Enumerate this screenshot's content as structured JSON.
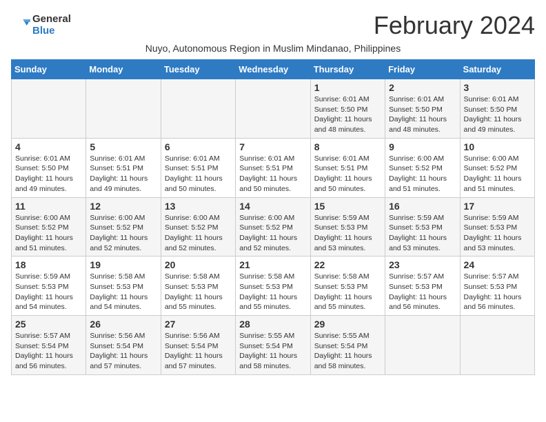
{
  "logo": {
    "general": "General",
    "blue": "Blue"
  },
  "title": "February 2024",
  "subtitle": "Nuyo, Autonomous Region in Muslim Mindanao, Philippines",
  "weekdays": [
    "Sunday",
    "Monday",
    "Tuesday",
    "Wednesday",
    "Thursday",
    "Friday",
    "Saturday"
  ],
  "weeks": [
    [
      {
        "day": "",
        "info": ""
      },
      {
        "day": "",
        "info": ""
      },
      {
        "day": "",
        "info": ""
      },
      {
        "day": "",
        "info": ""
      },
      {
        "day": "1",
        "sunrise": "6:01 AM",
        "sunset": "5:50 PM",
        "daylight": "11 hours and 48 minutes."
      },
      {
        "day": "2",
        "sunrise": "6:01 AM",
        "sunset": "5:50 PM",
        "daylight": "11 hours and 48 minutes."
      },
      {
        "day": "3",
        "sunrise": "6:01 AM",
        "sunset": "5:50 PM",
        "daylight": "11 hours and 49 minutes."
      }
    ],
    [
      {
        "day": "4",
        "sunrise": "6:01 AM",
        "sunset": "5:50 PM",
        "daylight": "11 hours and 49 minutes."
      },
      {
        "day": "5",
        "sunrise": "6:01 AM",
        "sunset": "5:51 PM",
        "daylight": "11 hours and 49 minutes."
      },
      {
        "day": "6",
        "sunrise": "6:01 AM",
        "sunset": "5:51 PM",
        "daylight": "11 hours and 50 minutes."
      },
      {
        "day": "7",
        "sunrise": "6:01 AM",
        "sunset": "5:51 PM",
        "daylight": "11 hours and 50 minutes."
      },
      {
        "day": "8",
        "sunrise": "6:01 AM",
        "sunset": "5:51 PM",
        "daylight": "11 hours and 50 minutes."
      },
      {
        "day": "9",
        "sunrise": "6:00 AM",
        "sunset": "5:52 PM",
        "daylight": "11 hours and 51 minutes."
      },
      {
        "day": "10",
        "sunrise": "6:00 AM",
        "sunset": "5:52 PM",
        "daylight": "11 hours and 51 minutes."
      }
    ],
    [
      {
        "day": "11",
        "sunrise": "6:00 AM",
        "sunset": "5:52 PM",
        "daylight": "11 hours and 51 minutes."
      },
      {
        "day": "12",
        "sunrise": "6:00 AM",
        "sunset": "5:52 PM",
        "daylight": "11 hours and 52 minutes."
      },
      {
        "day": "13",
        "sunrise": "6:00 AM",
        "sunset": "5:52 PM",
        "daylight": "11 hours and 52 minutes."
      },
      {
        "day": "14",
        "sunrise": "6:00 AM",
        "sunset": "5:52 PM",
        "daylight": "11 hours and 52 minutes."
      },
      {
        "day": "15",
        "sunrise": "5:59 AM",
        "sunset": "5:53 PM",
        "daylight": "11 hours and 53 minutes."
      },
      {
        "day": "16",
        "sunrise": "5:59 AM",
        "sunset": "5:53 PM",
        "daylight": "11 hours and 53 minutes."
      },
      {
        "day": "17",
        "sunrise": "5:59 AM",
        "sunset": "5:53 PM",
        "daylight": "11 hours and 53 minutes."
      }
    ],
    [
      {
        "day": "18",
        "sunrise": "5:59 AM",
        "sunset": "5:53 PM",
        "daylight": "11 hours and 54 minutes."
      },
      {
        "day": "19",
        "sunrise": "5:58 AM",
        "sunset": "5:53 PM",
        "daylight": "11 hours and 54 minutes."
      },
      {
        "day": "20",
        "sunrise": "5:58 AM",
        "sunset": "5:53 PM",
        "daylight": "11 hours and 55 minutes."
      },
      {
        "day": "21",
        "sunrise": "5:58 AM",
        "sunset": "5:53 PM",
        "daylight": "11 hours and 55 minutes."
      },
      {
        "day": "22",
        "sunrise": "5:58 AM",
        "sunset": "5:53 PM",
        "daylight": "11 hours and 55 minutes."
      },
      {
        "day": "23",
        "sunrise": "5:57 AM",
        "sunset": "5:53 PM",
        "daylight": "11 hours and 56 minutes."
      },
      {
        "day": "24",
        "sunrise": "5:57 AM",
        "sunset": "5:53 PM",
        "daylight": "11 hours and 56 minutes."
      }
    ],
    [
      {
        "day": "25",
        "sunrise": "5:57 AM",
        "sunset": "5:54 PM",
        "daylight": "11 hours and 56 minutes."
      },
      {
        "day": "26",
        "sunrise": "5:56 AM",
        "sunset": "5:54 PM",
        "daylight": "11 hours and 57 minutes."
      },
      {
        "day": "27",
        "sunrise": "5:56 AM",
        "sunset": "5:54 PM",
        "daylight": "11 hours and 57 minutes."
      },
      {
        "day": "28",
        "sunrise": "5:55 AM",
        "sunset": "5:54 PM",
        "daylight": "11 hours and 58 minutes."
      },
      {
        "day": "29",
        "sunrise": "5:55 AM",
        "sunset": "5:54 PM",
        "daylight": "11 hours and 58 minutes."
      },
      {
        "day": "",
        "info": ""
      },
      {
        "day": "",
        "info": ""
      }
    ]
  ],
  "daylight_label": "Daylight:"
}
